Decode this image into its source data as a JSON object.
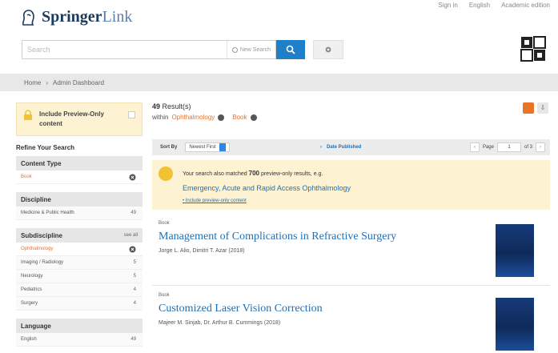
{
  "header": {
    "logo_brand": "Springer",
    "logo_product": "Link",
    "top_links": [
      "Sign in",
      "English",
      "Academic edition"
    ],
    "search_placeholder": "Search",
    "new_search_label": "New Search"
  },
  "breadcrumb": [
    "Home",
    "Admin Dashboard"
  ],
  "sidebar": {
    "preview_label": "Include Preview-Only content",
    "refine_title": "Refine Your Search",
    "facets": [
      {
        "title": "Content Type",
        "see_all": "",
        "items": [
          {
            "label": "Book",
            "count": "",
            "selected": true
          }
        ]
      },
      {
        "title": "Discipline",
        "see_all": "",
        "items": [
          {
            "label": "Medicine & Public Health",
            "count": "49"
          }
        ]
      },
      {
        "title": "Subdiscipline",
        "see_all": "see all",
        "items": [
          {
            "label": "Ophthalmology",
            "count": "",
            "selected": true
          },
          {
            "label": "Imaging / Radiology",
            "count": "5"
          },
          {
            "label": "Neurology",
            "count": "5"
          },
          {
            "label": "Pediatrics",
            "count": "4"
          },
          {
            "label": "Surgery",
            "count": "4"
          }
        ]
      },
      {
        "title": "Language",
        "see_all": "",
        "items": [
          {
            "label": "English",
            "count": "49"
          }
        ]
      }
    ]
  },
  "main": {
    "results_count": "49",
    "results_label": "Result(s)",
    "within_label": "within",
    "within_filter_1": "Ophthalmology",
    "within_filter_2": "Book",
    "sort_label": "Sort By",
    "sort_value": "Newest First",
    "date_published_label": "Date Published",
    "page_label": "Page",
    "page_value": "1",
    "page_of": "of 3",
    "notice": {
      "line1_prefix": "Your search also matched",
      "line1_count": "700",
      "line1_suffix": "preview-only results, e.g.",
      "example_title": "Emergency, Acute and Rapid Access Ophthalmology",
      "include_link": "• Include preview-only content"
    },
    "results": [
      {
        "type": "Book",
        "title": "Management of Complications in Refractive Surgery",
        "authors": "Jorge L. Alio, Dimitri T. Azar (2018)"
      },
      {
        "type": "Book",
        "title": "Customized Laser Vision Correction",
        "authors": "Majeer M. Sinjab, Dr. Arthur B. Cummings (2018)"
      }
    ]
  },
  "colors": {
    "accent_blue": "#1f80c8",
    "link_blue": "#1f6fb6",
    "accent_orange": "#e8742a",
    "notice_bg": "#fdf2d2"
  }
}
